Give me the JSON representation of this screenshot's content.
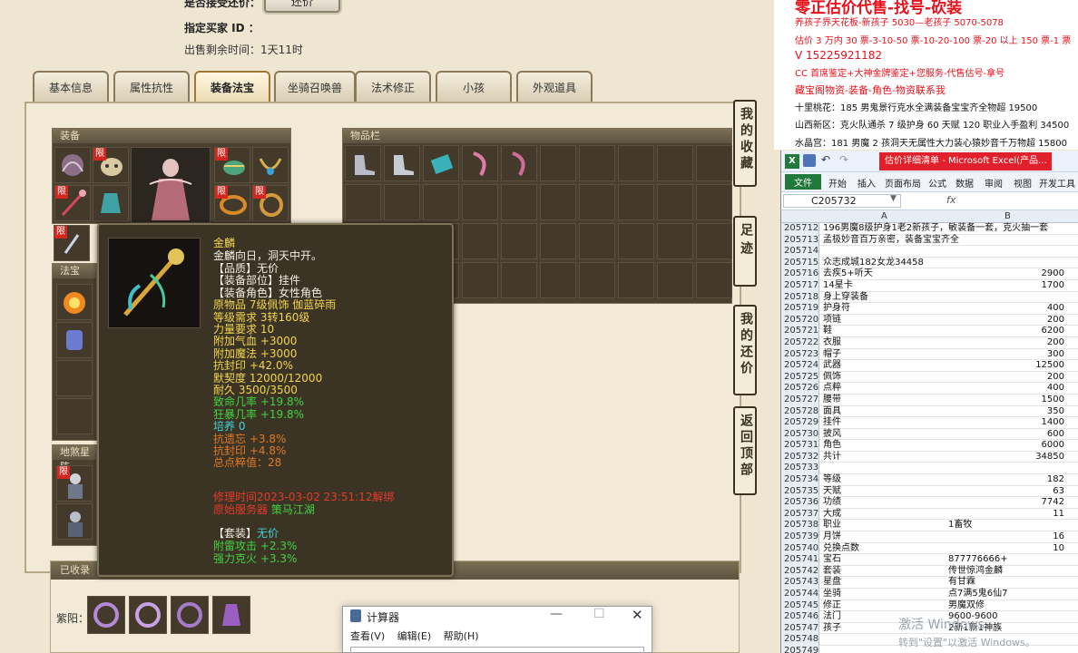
{
  "header": {
    "direct_sell_label": "是否接受还价：",
    "bargain_button": "还价",
    "buyer_label": "指定买家 ID ：",
    "remaining_label": "出售剩余时间：",
    "remaining_value": "1天11时"
  },
  "tabs": [
    "基本信息",
    "属性抗性",
    "装备法宝",
    "坐骑召唤兽",
    "法术修正",
    "小孩",
    "外观道具"
  ],
  "active_tab": "装备法宝",
  "equipment": {
    "title": "装备",
    "limit_badge": "限"
  },
  "inventory": {
    "title": "物品栏"
  },
  "fabao": {
    "title": "法宝"
  },
  "earth_star": {
    "title": "地煞星阵"
  },
  "collected": {
    "title": "已收录",
    "linked_label": "紫阳："
  },
  "side_nav": [
    {
      "label": "我的收藏"
    },
    {
      "label": "足迹"
    },
    {
      "label": "我的还价"
    },
    {
      "label": "返回顶部"
    }
  ],
  "tooltip": {
    "name": "金麟",
    "desc": "金麟向日，洞天中开。",
    "lines": [
      {
        "text": "【品质】无价",
        "color": "#f3efe3"
      },
      {
        "text": "【装备部位】挂件",
        "color": "#f3efe3"
      },
      {
        "text": "【装备角色】女性角色",
        "color": "#f3efe3"
      },
      {
        "text": "原物品 7级佩饰 伽蓝碎雨",
        "color": "#f3d54e"
      },
      {
        "text": "等级需求 3转160级",
        "color": "#f3d54e"
      },
      {
        "text": "力量要求 10",
        "color": "#f3d54e"
      },
      {
        "text": "附加气血 +3000",
        "color": "#f3d54e"
      },
      {
        "text": "附加魔法 +3000",
        "color": "#f3d54e"
      },
      {
        "text": "抗封印 +42.0%",
        "color": "#f3d54e"
      },
      {
        "text": "默契度 12000/12000",
        "color": "#f3d54e"
      },
      {
        "text": "耐久 3500/3500",
        "color": "#f3d54e"
      },
      {
        "text": "致命几率 +19.8%",
        "color": "#43d243"
      },
      {
        "text": "狂暴几率 +19.8%",
        "color": "#43d243"
      },
      {
        "text": "培养 0",
        "color": "#43d1d8"
      },
      {
        "text": "抗遗忘 +3.8%",
        "color": "#e07a28"
      },
      {
        "text": "抗封印 +4.8%",
        "color": "#e07a28"
      },
      {
        "text": "总点粹值：28",
        "color": "#e07a28"
      }
    ],
    "repair": "修理时间2023-03-02 23:51:12解绑",
    "origin_label": "原始服务器",
    "origin_value": "策马江湖",
    "set_label": "【套装】",
    "set_value": "无价",
    "set_lines": [
      "附雷攻击 +2.3%",
      "强力克火 +3.3%"
    ]
  },
  "calculator": {
    "title": "计算器",
    "menu": [
      "查看(V)",
      "编辑(E)",
      "帮助(H)"
    ]
  },
  "red_panel": {
    "lines": [
      {
        "text": "零正估价代售-找号-砍装",
        "color": "#e8101a",
        "size": 17,
        "bold": true
      },
      {
        "text": "养孩子界天花板-新孩子 5030—老孩子 5070-5078",
        "color": "#e8101a",
        "size": 10,
        "bold": false
      },
      {
        "text": "估价 3 万内 30 票-3-10-50 票-10-20-100 票-20 以上 150 票-1 票",
        "color": "#e8101a",
        "size": 10,
        "bold": false
      },
      {
        "text": "V 15225921182",
        "color": "#e8101a",
        "size": 12,
        "bold": false
      },
      {
        "text": "CC 首席鉴定+大神金牌鉴定+您服务-代售估号-拿号",
        "color": "#e8101a",
        "size": 10,
        "bold": false
      },
      {
        "text": "藏宝阁物资-装备-角色-物资联系我",
        "color": "#e8101a",
        "size": 11,
        "bold": false
      },
      {
        "text": "十里桃花：185 男鬼景行克水全满装备宝宝齐全物超 19500",
        "color": "#111111",
        "size": 10,
        "bold": false
      },
      {
        "text": "山西新区：克火队通杀 7 级护身 60 天赋 120 职业入手盈利 34500",
        "color": "#111111",
        "size": 10,
        "bold": false
      },
      {
        "text": "水晶宫：181 男魔 2 孩洞天无属性大力装心猿妙音千万物超 15800",
        "color": "#111111",
        "size": 10,
        "bold": false
      }
    ]
  },
  "excel": {
    "window_title": "估价详细清单 - Microsoft Excel(产品...",
    "ribbon": [
      "文件",
      "开始",
      "插入",
      "页面布局",
      "公式",
      "数据",
      "审阅",
      "视图",
      "开发工具"
    ],
    "name_box": "C205732",
    "fx": "fx",
    "columns": [
      "A",
      "B"
    ],
    "rows": [
      {
        "n": "205712",
        "a": "196男魔8级护身1老2新孩子，敏装备一套，克火抽一套",
        "b": ""
      },
      {
        "n": "205713",
        "a": "孟极妙音百万亲密，装备宝宝齐全",
        "b": ""
      },
      {
        "n": "205714",
        "a": "",
        "b": ""
      },
      {
        "n": "205715",
        "a": "众志成城182女龙34458",
        "b": ""
      },
      {
        "n": "205716",
        "a": "去疾5+听天",
        "b": "2900"
      },
      {
        "n": "205717",
        "a": "14星卡",
        "b": "1700"
      },
      {
        "n": "205718",
        "a": "身上穿装备",
        "b": ""
      },
      {
        "n": "205719",
        "a": "护身符",
        "b": "400"
      },
      {
        "n": "205720",
        "a": "项链",
        "b": "200"
      },
      {
        "n": "205721",
        "a": "鞋",
        "b": "6200"
      },
      {
        "n": "205722",
        "a": "衣服",
        "b": "200"
      },
      {
        "n": "205723",
        "a": "帽子",
        "b": "300"
      },
      {
        "n": "205724",
        "a": "武器",
        "b": "12500"
      },
      {
        "n": "205725",
        "a": "佩饰",
        "b": "200"
      },
      {
        "n": "205726",
        "a": "点粹",
        "b": "400"
      },
      {
        "n": "205727",
        "a": "腰带",
        "b": "1500"
      },
      {
        "n": "205728",
        "a": "面具",
        "b": "350"
      },
      {
        "n": "205729",
        "a": "挂件",
        "b": "1400"
      },
      {
        "n": "205730",
        "a": "披风",
        "b": "600"
      },
      {
        "n": "205731",
        "a": "角色",
        "b": "6000"
      },
      {
        "n": "205732",
        "a": "共计",
        "b": "34850"
      },
      {
        "n": "205733",
        "a": "",
        "b": ""
      },
      {
        "n": "205734",
        "a": "等级",
        "b": "182"
      },
      {
        "n": "205735",
        "a": "天赋",
        "b": "63"
      },
      {
        "n": "205736",
        "a": "功绩",
        "b": "7742"
      },
      {
        "n": "205737",
        "a": "大成",
        "b": "11"
      },
      {
        "n": "205738",
        "a": "职业",
        "bt": "1畜牧"
      },
      {
        "n": "205739",
        "a": "月饼",
        "b": "16"
      },
      {
        "n": "205740",
        "a": "兑换点数",
        "b": "10"
      },
      {
        "n": "205741",
        "a": "宝石",
        "bt": "877776666+"
      },
      {
        "n": "205742",
        "a": "套装",
        "bt": "传世惊鸿金麟"
      },
      {
        "n": "205743",
        "a": "星盘",
        "bt": "有甘霖"
      },
      {
        "n": "205744",
        "a": "坐骑",
        "bt": "点7满5鬼6仙7"
      },
      {
        "n": "205745",
        "a": "修正",
        "bt": "男魔双修"
      },
      {
        "n": "205746",
        "a": "法门",
        "bt": "9600-9600"
      },
      {
        "n": "205747",
        "a": "孩子",
        "bt": "2新1新1神族"
      },
      {
        "n": "205748",
        "a": "",
        "b": ""
      },
      {
        "n": "205749",
        "a": "",
        "b": ""
      }
    ]
  },
  "watermark": {
    "line1": "激活 Windows",
    "line2": "转到\"设置\"以激活 Windows。"
  }
}
